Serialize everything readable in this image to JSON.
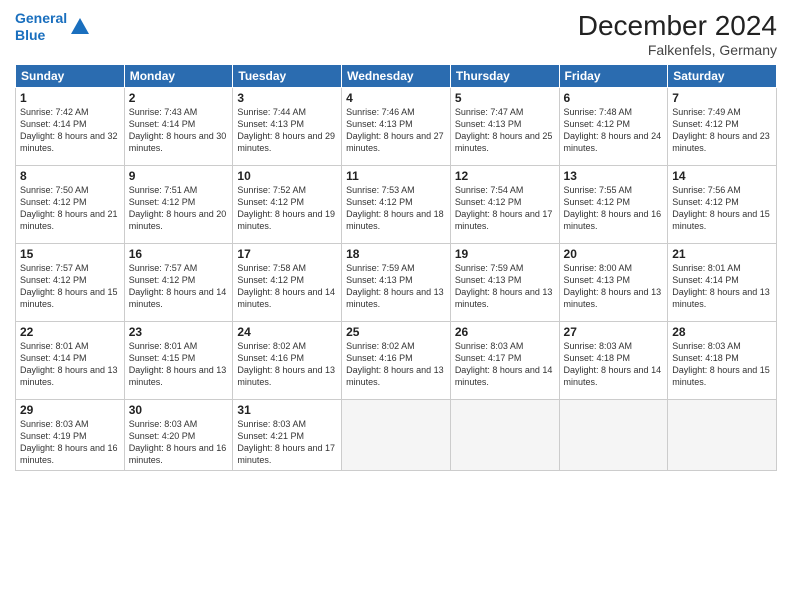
{
  "header": {
    "logo_line1": "General",
    "logo_line2": "Blue",
    "month": "December 2024",
    "location": "Falkenfels, Germany"
  },
  "days_of_week": [
    "Sunday",
    "Monday",
    "Tuesday",
    "Wednesday",
    "Thursday",
    "Friday",
    "Saturday"
  ],
  "weeks": [
    [
      {
        "day": 1,
        "rise": "7:42 AM",
        "set": "4:14 PM",
        "daylight": "8 hours and 32 minutes."
      },
      {
        "day": 2,
        "rise": "7:43 AM",
        "set": "4:14 PM",
        "daylight": "8 hours and 30 minutes."
      },
      {
        "day": 3,
        "rise": "7:44 AM",
        "set": "4:13 PM",
        "daylight": "8 hours and 29 minutes."
      },
      {
        "day": 4,
        "rise": "7:46 AM",
        "set": "4:13 PM",
        "daylight": "8 hours and 27 minutes."
      },
      {
        "day": 5,
        "rise": "7:47 AM",
        "set": "4:13 PM",
        "daylight": "8 hours and 25 minutes."
      },
      {
        "day": 6,
        "rise": "7:48 AM",
        "set": "4:12 PM",
        "daylight": "8 hours and 24 minutes."
      },
      {
        "day": 7,
        "rise": "7:49 AM",
        "set": "4:12 PM",
        "daylight": "8 hours and 23 minutes."
      }
    ],
    [
      {
        "day": 8,
        "rise": "7:50 AM",
        "set": "4:12 PM",
        "daylight": "8 hours and 21 minutes."
      },
      {
        "day": 9,
        "rise": "7:51 AM",
        "set": "4:12 PM",
        "daylight": "8 hours and 20 minutes."
      },
      {
        "day": 10,
        "rise": "7:52 AM",
        "set": "4:12 PM",
        "daylight": "8 hours and 19 minutes."
      },
      {
        "day": 11,
        "rise": "7:53 AM",
        "set": "4:12 PM",
        "daylight": "8 hours and 18 minutes."
      },
      {
        "day": 12,
        "rise": "7:54 AM",
        "set": "4:12 PM",
        "daylight": "8 hours and 17 minutes."
      },
      {
        "day": 13,
        "rise": "7:55 AM",
        "set": "4:12 PM",
        "daylight": "8 hours and 16 minutes."
      },
      {
        "day": 14,
        "rise": "7:56 AM",
        "set": "4:12 PM",
        "daylight": "8 hours and 15 minutes."
      }
    ],
    [
      {
        "day": 15,
        "rise": "7:57 AM",
        "set": "4:12 PM",
        "daylight": "8 hours and 15 minutes."
      },
      {
        "day": 16,
        "rise": "7:57 AM",
        "set": "4:12 PM",
        "daylight": "8 hours and 14 minutes."
      },
      {
        "day": 17,
        "rise": "7:58 AM",
        "set": "4:12 PM",
        "daylight": "8 hours and 14 minutes."
      },
      {
        "day": 18,
        "rise": "7:59 AM",
        "set": "4:13 PM",
        "daylight": "8 hours and 13 minutes."
      },
      {
        "day": 19,
        "rise": "7:59 AM",
        "set": "4:13 PM",
        "daylight": "8 hours and 13 minutes."
      },
      {
        "day": 20,
        "rise": "8:00 AM",
        "set": "4:13 PM",
        "daylight": "8 hours and 13 minutes."
      },
      {
        "day": 21,
        "rise": "8:01 AM",
        "set": "4:14 PM",
        "daylight": "8 hours and 13 minutes."
      }
    ],
    [
      {
        "day": 22,
        "rise": "8:01 AM",
        "set": "4:14 PM",
        "daylight": "8 hours and 13 minutes."
      },
      {
        "day": 23,
        "rise": "8:01 AM",
        "set": "4:15 PM",
        "daylight": "8 hours and 13 minutes."
      },
      {
        "day": 24,
        "rise": "8:02 AM",
        "set": "4:16 PM",
        "daylight": "8 hours and 13 minutes."
      },
      {
        "day": 25,
        "rise": "8:02 AM",
        "set": "4:16 PM",
        "daylight": "8 hours and 13 minutes."
      },
      {
        "day": 26,
        "rise": "8:03 AM",
        "set": "4:17 PM",
        "daylight": "8 hours and 14 minutes."
      },
      {
        "day": 27,
        "rise": "8:03 AM",
        "set": "4:18 PM",
        "daylight": "8 hours and 14 minutes."
      },
      {
        "day": 28,
        "rise": "8:03 AM",
        "set": "4:18 PM",
        "daylight": "8 hours and 15 minutes."
      }
    ],
    [
      {
        "day": 29,
        "rise": "8:03 AM",
        "set": "4:19 PM",
        "daylight": "8 hours and 16 minutes."
      },
      {
        "day": 30,
        "rise": "8:03 AM",
        "set": "4:20 PM",
        "daylight": "8 hours and 16 minutes."
      },
      {
        "day": 31,
        "rise": "8:03 AM",
        "set": "4:21 PM",
        "daylight": "8 hours and 17 minutes."
      },
      null,
      null,
      null,
      null
    ]
  ]
}
